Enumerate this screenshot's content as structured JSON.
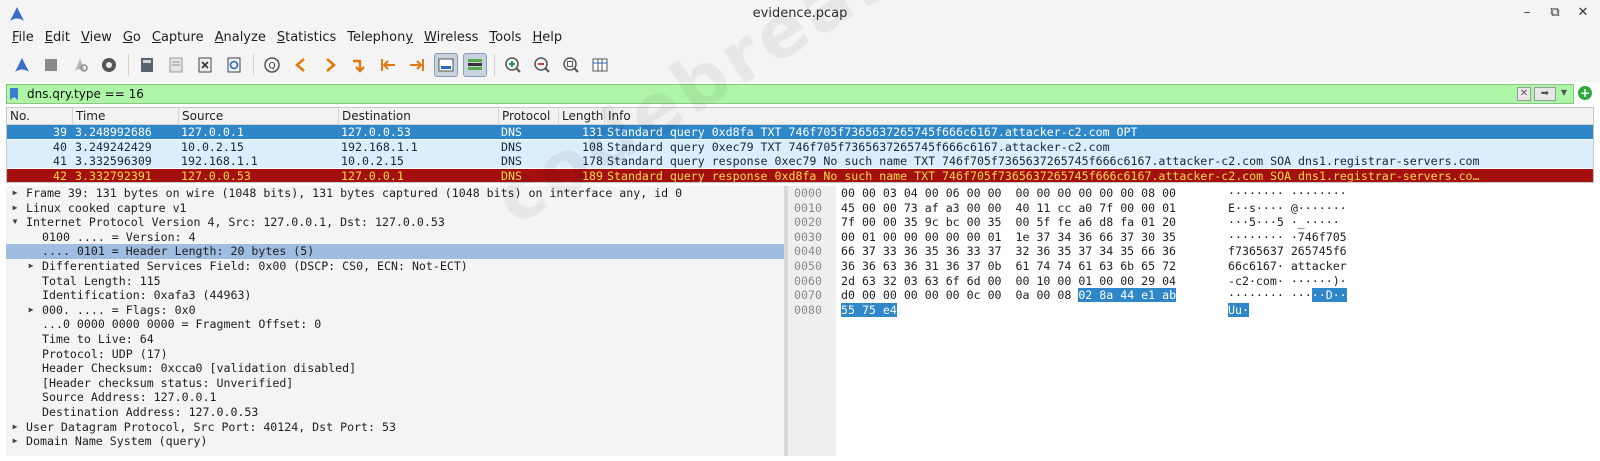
{
  "window": {
    "title": "evidence.pcap"
  },
  "menu": [
    {
      "u": "F",
      "rest": "ile"
    },
    {
      "u": "E",
      "rest": "dit"
    },
    {
      "u": "V",
      "rest": "iew"
    },
    {
      "u": "G",
      "rest": "o"
    },
    {
      "u": "C",
      "rest": "apture"
    },
    {
      "u": "A",
      "rest": "nalyze"
    },
    {
      "u": "S",
      "rest": "tatistics"
    },
    {
      "u": "",
      "rest": "Telephon",
      "u2": "y"
    },
    {
      "u": "W",
      "rest": "ireless"
    },
    {
      "u": "T",
      "rest": "ools"
    },
    {
      "u": "H",
      "rest": "elp"
    }
  ],
  "toolbar": {
    "icons": [
      "shark-fin-icon",
      "stop-icon",
      "restart-icon",
      "options-gear-icon",
      "open-file-icon",
      "save-file-icon",
      "close-file-icon",
      "reload-icon",
      "find-icon",
      "back-icon",
      "forward-icon",
      "jump-icon",
      "first-packet-icon",
      "last-packet-icon",
      "autoscroll-icon",
      "colorize-icon",
      "zoom-in-icon",
      "zoom-out-icon",
      "zoom-reset-icon",
      "resize-columns-icon"
    ]
  },
  "filter": {
    "value": "dns.qry.type == 16"
  },
  "packet_list": {
    "columns": [
      "No.",
      "Time",
      "Source",
      "Destination",
      "Protocol",
      "Length",
      "Info"
    ],
    "rows": [
      {
        "no": "39",
        "time": "3.248992686",
        "src": "127.0.0.1",
        "dst": "127.0.0.53",
        "proto": "DNS",
        "len": "131",
        "info": "Standard query 0xd8fa TXT 746f705f7365637265745f666c6167.attacker-c2.com OPT",
        "style": "selected"
      },
      {
        "no": "40",
        "time": "3.249242429",
        "src": "10.0.2.15",
        "dst": "192.168.1.1",
        "proto": "DNS",
        "len": "108",
        "info": "Standard query 0xec79 TXT 746f705f7365637265745f666c6167.attacker-c2.com",
        "style": "lightblue"
      },
      {
        "no": "41",
        "time": "3.332596309",
        "src": "192.168.1.1",
        "dst": "10.0.2.15",
        "proto": "DNS",
        "len": "178",
        "info": "Standard query response 0xec79 No such name TXT 746f705f7365637265745f666c6167.attacker-c2.com SOA dns1.registrar-servers.com",
        "style": "lightblue"
      },
      {
        "no": "42",
        "time": "3.332792391",
        "src": "127.0.0.53",
        "dst": "127.0.0.1",
        "proto": "DNS",
        "len": "189",
        "info": "Standard query response 0xd8fa No such name TXT 746f705f7365637265745f666c6167.attacker-c2.com SOA dns1.registrar-servers.co…",
        "style": "error"
      }
    ]
  },
  "details": [
    {
      "indent": 0,
      "arrow": "right",
      "text": "Frame 39: 131 bytes on wire (1048 bits), 131 bytes captured (1048 bits) on interface any, id 0"
    },
    {
      "indent": 0,
      "arrow": "right",
      "text": "Linux cooked capture v1"
    },
    {
      "indent": 0,
      "arrow": "down",
      "text": "Internet Protocol Version 4, Src: 127.0.0.1, Dst: 127.0.0.53"
    },
    {
      "indent": 1,
      "arrow": "",
      "text": "0100 .... = Version: 4"
    },
    {
      "indent": 1,
      "arrow": "",
      "text": ".... 0101 = Header Length: 20 bytes (5)",
      "highlight": true
    },
    {
      "indent": 1,
      "arrow": "right",
      "text": "Differentiated Services Field: 0x00 (DSCP: CS0, ECN: Not-ECT)"
    },
    {
      "indent": 1,
      "arrow": "",
      "text": "Total Length: 115"
    },
    {
      "indent": 1,
      "arrow": "",
      "text": "Identification: 0xafa3 (44963)"
    },
    {
      "indent": 1,
      "arrow": "right",
      "text": "000. .... = Flags: 0x0"
    },
    {
      "indent": 1,
      "arrow": "",
      "text": "...0 0000 0000 0000 = Fragment Offset: 0"
    },
    {
      "indent": 1,
      "arrow": "",
      "text": "Time to Live: 64"
    },
    {
      "indent": 1,
      "arrow": "",
      "text": "Protocol: UDP (17)"
    },
    {
      "indent": 1,
      "arrow": "",
      "text": "Header Checksum: 0xcca0 [validation disabled]"
    },
    {
      "indent": 1,
      "arrow": "",
      "text": "[Header checksum status: Unverified]"
    },
    {
      "indent": 1,
      "arrow": "",
      "text": "Source Address: 127.0.0.1"
    },
    {
      "indent": 1,
      "arrow": "",
      "text": "Destination Address: 127.0.0.53"
    },
    {
      "indent": 0,
      "arrow": "right",
      "text": "User Datagram Protocol, Src Port: 40124, Dst Port: 53"
    },
    {
      "indent": 0,
      "arrow": "right",
      "text": "Domain Name System (query)"
    }
  ],
  "bytes": [
    {
      "off": "0000",
      "hex": "00 00 03 04 00 06 00 00  00 00 00 00 00 00 08 00",
      "asc": "········ ········"
    },
    {
      "off": "0010",
      "hex": "45 00 00 73 af a3 00 00  40 11 cc a0 7f 00 00 01",
      "asc": "E··s···· @·······"
    },
    {
      "off": "0020",
      "hex": "7f 00 00 35 9c bc 00 35  00 5f fe a6 d8 fa 01 20",
      "asc": "···5···5 ·_····· "
    },
    {
      "off": "0030",
      "hex": "00 01 00 00 00 00 00 01  1e 37 34 36 66 37 30 35",
      "asc": "········ ·746f705"
    },
    {
      "off": "0040",
      "hex": "66 37 33 36 35 36 33 37  32 36 35 37 34 35 66 36",
      "asc": "f7365637 265745f6"
    },
    {
      "off": "0050",
      "hex": "36 36 63 36 31 36 37 0b  61 74 74 61 63 6b 65 72",
      "asc": "66c6167· attacker"
    },
    {
      "off": "0060",
      "hex": "2d 63 32 03 63 6f 6d 00  00 10 00 01 00 00 29 04",
      "asc": "-c2·com· ······)·"
    },
    {
      "off": "0070",
      "hex": "d0 00 00 00 00 00 0c 00  0a 00 08 ",
      "hexsel": "02 8a 44 e1 ab",
      "asc": "········ ···",
      "ascsel": "··D··"
    },
    {
      "off": "0080",
      "hex": "",
      "hexsel": "55 75 e4",
      "asc": "",
      "ascsel": "Uu·"
    }
  ],
  "watermark": "codebreaker"
}
